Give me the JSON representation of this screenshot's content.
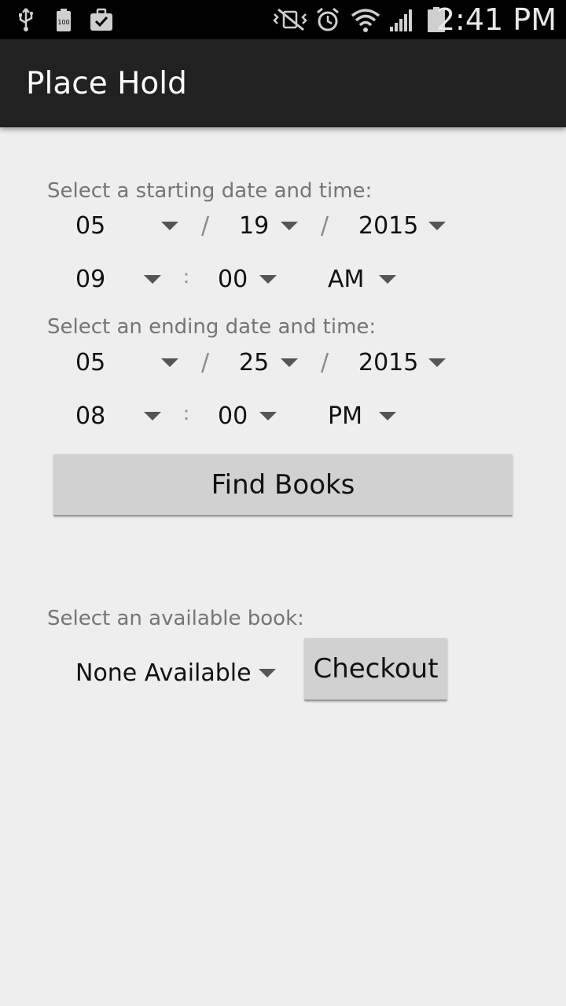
{
  "status_bar": {
    "time": "2:41 PM",
    "left_icons": [
      "usb-icon",
      "battery-full-icon",
      "task-briefcase-icon"
    ],
    "right_icons": [
      "vibrate-silent-icon",
      "alarm-icon",
      "wifi-icon",
      "signal-icon",
      "battery-icon"
    ]
  },
  "action_bar": {
    "title": "Place Hold"
  },
  "start": {
    "label": "Select a starting date and time:",
    "month": "05",
    "day": "19",
    "year": "2015",
    "hour": "09",
    "minute": "00",
    "ampm": "AM"
  },
  "end": {
    "label": "Select an ending date and time:",
    "month": "05",
    "day": "25",
    "year": "2015",
    "hour": "08",
    "minute": "00",
    "ampm": "PM"
  },
  "separators": {
    "date": "/",
    "time": ":"
  },
  "find_button": {
    "label": "Find Books"
  },
  "book": {
    "label": "Select an available book:",
    "selected": "None Available"
  },
  "checkout_button": {
    "label": "Checkout"
  },
  "colors": {
    "status_bar": "#000000",
    "action_bar": "#212121",
    "background": "#eeeeee",
    "button": "#d1d1d1",
    "label_text": "#757575"
  }
}
